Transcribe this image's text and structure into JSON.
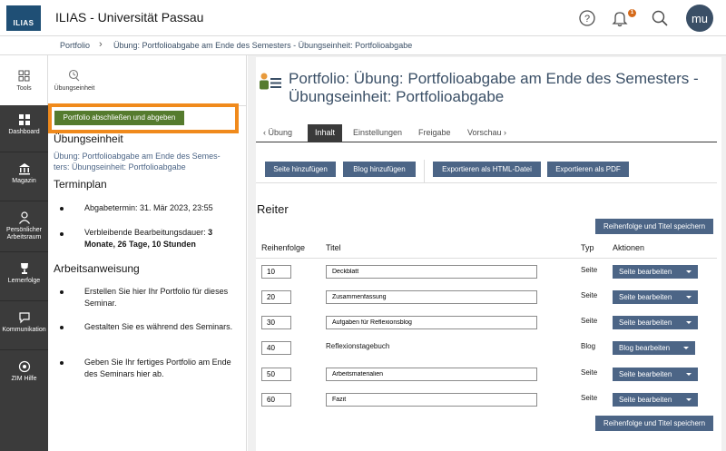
{
  "header": {
    "logo_text": "ILIAS",
    "title": "ILIAS - Universität Passau",
    "help_icon": "help-icon",
    "notification_icon": "bell-icon",
    "notification_count": "1",
    "search_icon": "search-icon",
    "avatar_initials": "mu"
  },
  "breadcrumb": {
    "items": [
      "Portfolio",
      "Übung: Portfolioabgabe am Ende des Semesters - Übungseinheit: Portfolioabgabe"
    ]
  },
  "rail": {
    "tools_label": "Tools",
    "items": [
      {
        "label": "Dashboard",
        "icon": "dashboard-icon"
      },
      {
        "label": "Magazin",
        "icon": "library-icon"
      },
      {
        "label": "Persönlicher Arbeitsraum",
        "icon": "person-icon"
      },
      {
        "label": "Lernerfolge",
        "icon": "trophy-icon"
      },
      {
        "label": "Kommunikation",
        "icon": "chat-icon"
      },
      {
        "label": "ZIM Hilfe",
        "icon": "help-circle-icon"
      }
    ]
  },
  "slate": {
    "tab_label": "Übungseinheit",
    "submit_button": "Portfolio abschließen und abgeben",
    "heading": "Übungseinheit",
    "assignment_text": "Übung: Portfolioabgabe am Ende des Semes-\nters: Übungseinheit: Portfolioabgabe",
    "schedule_heading": "Terminplan",
    "deadline": "Abgabetermin: 31. Mär 2023, 23:55",
    "remaining_prefix": "Verbleibende Bearbeitungsdauer:",
    "remaining_value": "3 Monate, 26 Tage, 10 Stunden",
    "instruction_heading": "Arbeitsanweisung",
    "instructions": [
      "Erstellen Sie hier Ihr Portfolio für dieses Seminar.",
      "Gestalten Sie es während des Seminars.",
      "Geben Sie Ihr fertiges Portfolio am Ende des Seminars hier ab."
    ]
  },
  "main": {
    "title": "Portfolio: Übung: Portfolioabgabe am Ende des Semesters - Übungseinheit: Portfolioabgabe",
    "tabs": [
      {
        "label": "Übung",
        "back": true
      },
      {
        "label": "Inhalt",
        "active": true
      },
      {
        "label": "Einstellungen"
      },
      {
        "label": "Freigabe"
      },
      {
        "label": "Vorschau",
        "forward": true
      }
    ],
    "toolbar": {
      "add_page": "Seite hinzufügen",
      "add_blog": "Blog hinzufügen",
      "export_html": "Exportieren als HTML-Datei",
      "export_pdf": "Exportieren als PDF"
    },
    "section_title": "Reiter",
    "save_order_button": "Reihenfolge und Titel speichern",
    "columns": {
      "order": "Reihenfolge",
      "title": "Titel",
      "type": "Typ",
      "actions": "Aktionen"
    },
    "rows": [
      {
        "order": "10",
        "title": "Deckblatt",
        "type": "Seite",
        "action": "Seite bearbeiten"
      },
      {
        "order": "20",
        "title": "Zusammenfassung",
        "type": "Seite",
        "action": "Seite bearbeiten"
      },
      {
        "order": "30",
        "title": "Aufgaben für Reflexionsblog",
        "type": "Seite",
        "action": "Seite bearbeiten"
      },
      {
        "order": "40",
        "title": "Reflexionstagebuch",
        "type": "Blog",
        "action": "Blog bearbeiten"
      },
      {
        "order": "50",
        "title": "Arbeitsmaterialien",
        "type": "Seite",
        "action": "Seite bearbeiten"
      },
      {
        "order": "60",
        "title": "Fazit",
        "type": "Seite",
        "action": "Seite bearbeiten"
      }
    ]
  }
}
